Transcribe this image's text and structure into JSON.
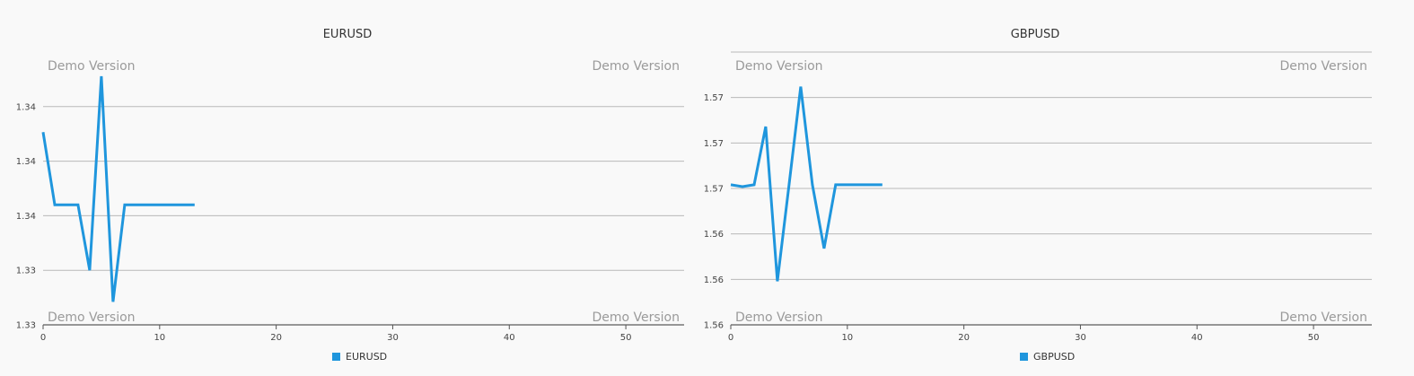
{
  "watermark": "Demo Version",
  "colors": {
    "series": "#1f96dd",
    "grid": "#b9b9b9",
    "background": "#f9f9f9"
  },
  "chart_data": [
    {
      "type": "line",
      "title": "EURUSD",
      "xlim": [
        0,
        55
      ],
      "xticks": [
        0,
        10,
        20,
        30,
        40,
        50
      ],
      "ylim": [
        1.325,
        1.3475
      ],
      "yticks": [
        1.325,
        1.3295,
        1.334,
        1.3385,
        1.343
      ],
      "ytick_labels": [
        "1.33",
        "1.33",
        "1.34",
        "1.34",
        "1.34"
      ],
      "grid": true,
      "legend": "bottom-center",
      "series": [
        {
          "name": "EURUSD",
          "x": [
            0,
            1,
            2,
            3,
            4,
            5,
            6,
            7,
            8,
            9,
            10,
            11,
            12,
            13
          ],
          "values": [
            1.3409,
            1.3349,
            1.3349,
            1.3349,
            1.3295,
            1.3455,
            1.3269,
            1.3349,
            1.3349,
            1.3349,
            1.3349,
            1.3349,
            1.3349,
            1.3349
          ]
        }
      ]
    },
    {
      "type": "line",
      "title": "GBPUSD",
      "xlim": [
        0,
        55
      ],
      "xticks": [
        0,
        10,
        20,
        30,
        40,
        50
      ],
      "ylim": [
        1.5575,
        1.5725
      ],
      "yticks": [
        1.5575,
        1.56,
        1.5625,
        1.565,
        1.5675,
        1.57,
        1.5725
      ],
      "ytick_labels": [
        "1.56",
        "1.56",
        "1.56",
        "1.57",
        "1.57",
        "1.57"
      ],
      "grid": true,
      "legend": "bottom-center",
      "series": [
        {
          "name": "GBPUSD",
          "x": [
            0,
            1,
            2,
            3,
            4,
            5,
            6,
            7,
            8,
            9,
            10,
            11,
            12,
            13
          ],
          "values": [
            1.5652,
            1.5651,
            1.5652,
            1.5684,
            1.5599,
            1.5652,
            1.5706,
            1.5652,
            1.5617,
            1.5652,
            1.5652,
            1.5652,
            1.5652,
            1.5652
          ]
        }
      ]
    }
  ]
}
